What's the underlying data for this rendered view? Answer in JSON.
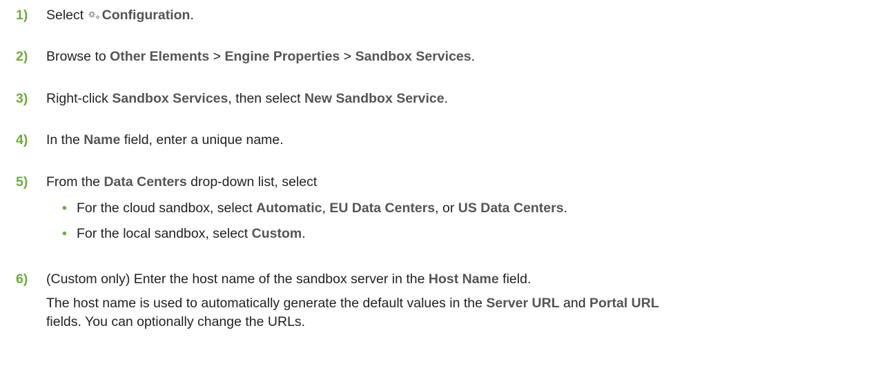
{
  "steps": [
    {
      "number": "1)",
      "parts": [
        "Select ",
        "",
        "Configuration",
        "."
      ],
      "icon": "configuration-gear-icon"
    },
    {
      "number": "2)",
      "parts": [
        "Browse to ",
        "Other Elements",
        " > ",
        "Engine Properties",
        " > ",
        "Sandbox Services",
        "."
      ]
    },
    {
      "number": "3)",
      "parts": [
        "Right-click ",
        "Sandbox Services",
        ", then select ",
        "New Sandbox Service",
        "."
      ]
    },
    {
      "number": "4)",
      "parts": [
        "In the ",
        "Name",
        " field, enter a unique name."
      ]
    },
    {
      "number": "5)",
      "parts": [
        "From the ",
        "Data Centers",
        " drop-down list, select"
      ],
      "bullets": [
        {
          "parts": [
            "For the cloud sandbox, select ",
            "Automatic",
            ", ",
            "EU Data Centers",
            ", or ",
            "US Data Centers",
            "."
          ]
        },
        {
          "parts": [
            "For the local sandbox, select ",
            "Custom",
            "."
          ]
        }
      ]
    },
    {
      "number": "6)",
      "parts": [
        "(Custom only) Enter the host name of the sandbox server in the ",
        "Host Name",
        " field."
      ],
      "note": {
        "line1": [
          "The host name is used to automatically generate the default values in the ",
          "Server URL",
          " and ",
          "Portal URL"
        ],
        "line2": "fields. You can optionally change the URLs."
      }
    }
  ],
  "bullet_glyph": "•",
  "colors": {
    "step_number": "#6dad3c",
    "bold_term": "#555555",
    "body_text": "#222222"
  }
}
